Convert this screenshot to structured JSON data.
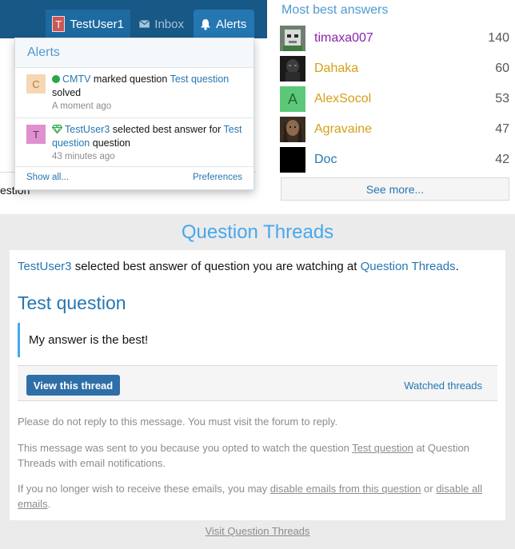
{
  "nav": {
    "user_avatar": "T",
    "user_name": "TestUser1",
    "inbox_label": "Inbox",
    "alerts_label": "Alerts"
  },
  "background": {
    "text_fragment": "estion"
  },
  "alerts_popup": {
    "title": "Alerts",
    "items": [
      {
        "avatar": "C",
        "user": "CMTV",
        "text_1": "marked question",
        "link": "Test question",
        "text_2": "solved",
        "time": "A moment ago",
        "icon": "green-dot-icon"
      },
      {
        "avatar": "T",
        "user": "TestUser3",
        "text_1": "selected best answer for",
        "link": "Test question",
        "text_2": "question",
        "time": "43 minutes ago",
        "icon": "gem-icon"
      }
    ],
    "show_all": "Show all...",
    "preferences": "Preferences"
  },
  "sidebar": {
    "title": "Most best answers",
    "members": [
      {
        "name": "timaxa007",
        "count": "140",
        "color": "#8e24aa"
      },
      {
        "name": "Dahaka",
        "count": "60",
        "color": "#d4a017"
      },
      {
        "name": "AlexSocol",
        "count": "53",
        "color": "#d4a017",
        "avatar_letter": "A"
      },
      {
        "name": "Agravaine",
        "count": "47",
        "color": "#d4a017"
      },
      {
        "name": "Doc",
        "count": "42",
        "color": "#2577b1"
      }
    ],
    "see_more": "See more..."
  },
  "email": {
    "header_title": "Question Threads",
    "intro_user": "TestUser3",
    "intro_text": "selected best answer of question you are watching at",
    "intro_forum": "Question Threads",
    "intro_end": ".",
    "question_title": "Test question",
    "quote": "My answer is the best!",
    "view_button": "View this thread",
    "watched_link": "Watched threads",
    "note_1": "Please do not reply to this message. You must visit the forum to reply.",
    "note_2_a": "This message was sent to you because you opted to watch the question",
    "note_2_link": "Test question",
    "note_2_b": "at Question Threads with email notifications.",
    "note_3_a": "If you no longer wish to receive these emails, you may",
    "note_3_link1": "disable emails from this question",
    "note_3_or": "or",
    "note_3_link2": "disable all emails",
    "note_3_end": ".",
    "visit_link": "Visit Question Threads"
  },
  "colors": {
    "nav_bg": "#185886",
    "accent": "#2577b1",
    "title_blue": "#47a7eb",
    "button_bg": "#2f6fa7"
  }
}
